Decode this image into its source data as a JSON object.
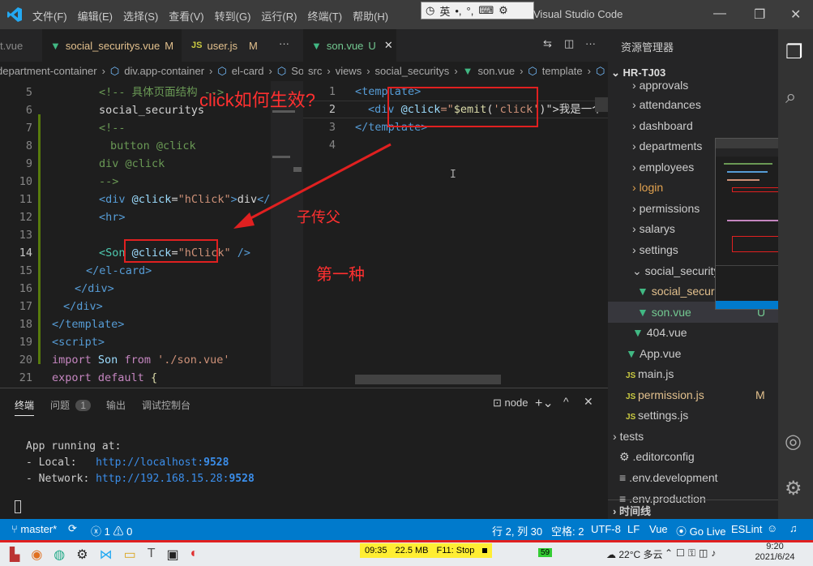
{
  "titlebar": {
    "menu": [
      "文件(F)",
      "编辑(E)",
      "选择(S)",
      "查看(V)",
      "转到(G)",
      "运行(R)",
      "终端(T)",
      "帮助(H)"
    ],
    "ime": {
      "circle": "◷",
      "lang": "英",
      "punct": "°,",
      "moon": "•,"
    },
    "window_title": "Visual Studio Code",
    "buttons": {
      "minimize": "—",
      "restore": "❐",
      "close": "✕"
    }
  },
  "left_editor": {
    "tabs": [
      {
        "label": "t.vue",
        "badge": ""
      },
      {
        "label": "social_securitys.vue",
        "badge": "M",
        "active": true
      },
      {
        "label": "user.js",
        "badge": "M",
        "prefix": "JS"
      }
    ],
    "more": "···",
    "breadcrumb": [
      "department-container",
      "div.app-container",
      "el-card",
      "Son"
    ],
    "lines": [
      {
        "n": "5",
        "html": "cmt1"
      },
      {
        "n": "6",
        "text": "social_securitys"
      },
      {
        "n": "7",
        "text": "<!--"
      },
      {
        "n": "8",
        "text": "button @click"
      },
      {
        "n": "9",
        "text": "div @click"
      },
      {
        "n": "10",
        "text": "-->"
      },
      {
        "n": "11"
      },
      {
        "n": "12"
      },
      {
        "n": "13"
      },
      {
        "n": "14"
      },
      {
        "n": "15"
      },
      {
        "n": "16"
      },
      {
        "n": "17"
      },
      {
        "n": "18"
      },
      {
        "n": "19"
      },
      {
        "n": "20"
      },
      {
        "n": "21"
      }
    ],
    "code": {
      "l5_comment": "<!-- 具体页面结构 -->",
      "l6": "social_securitys",
      "l7": "<!--",
      "l8": "button @click",
      "l9": "div @click",
      "l10": "-->",
      "l11_tag": "<div",
      "l11_attr": "@click",
      "l11_val": "\"hClick\"",
      "l11_rest": "div",
      "l11_close": "</div>",
      "l12": "<hr>",
      "l14_tag": "<Son",
      "l14_attr": "@click",
      "l14_val": "\"hClick\"",
      "l14_close": "/>",
      "l15": "</el-card>",
      "l16": "</div>",
      "l17": "</div>",
      "l18": "</template>",
      "l19": "<script>",
      "l20_kw": "import",
      "l20_name": "Son",
      "l20_from": "from",
      "l20_str": "'./son.vue'",
      "l21_kw": "export default",
      "l21_rest": "{"
    }
  },
  "annotations": {
    "question": "click如何生效?",
    "child_to_parent": "子传父",
    "first_way": "第一种"
  },
  "right_editor": {
    "tab": {
      "label": "son.vue",
      "badge": "U"
    },
    "breadcrumb": [
      "src",
      "views",
      "social_securitys",
      "son.vue",
      "template",
      "div"
    ],
    "line_numbers": [
      "1",
      "2",
      "3",
      "4"
    ],
    "code": {
      "l1": "<template>",
      "l2_tag": "<div",
      "l2_attr": "@click",
      "l2_eq": "=\"",
      "l2_fn": "$emit",
      "l2_arg": "'click'",
      "l2_tail": "\">我是一个",
      "l3": "</template>"
    }
  },
  "explorer": {
    "header": "资源管理器",
    "more": "···",
    "project": "HR-TJ03",
    "items": [
      {
        "label": "approvals",
        "type": "folder"
      },
      {
        "label": "attendances",
        "type": "folder"
      },
      {
        "label": "dashboard",
        "type": "folder"
      },
      {
        "label": "departments",
        "type": "folder"
      },
      {
        "label": "employees",
        "type": "folder"
      },
      {
        "label": "login",
        "type": "folder"
      },
      {
        "label": "permissions",
        "type": "folder"
      },
      {
        "label": "salarys",
        "type": "folder"
      },
      {
        "label": "settings",
        "type": "folder"
      },
      {
        "label": "social_securitys",
        "type": "folder-open"
      },
      {
        "label": "social_securitys",
        "type": "vue"
      },
      {
        "label": "son.vue",
        "type": "vue",
        "badge": "U"
      },
      {
        "label": "404.vue",
        "type": "vue"
      },
      {
        "label": "App.vue",
        "type": "vue"
      },
      {
        "label": "main.js",
        "type": "js"
      },
      {
        "label": "permission.js",
        "type": "js",
        "badge": "M"
      },
      {
        "label": "settings.js",
        "type": "js"
      },
      {
        "label": "tests",
        "type": "folder"
      },
      {
        "label": ".editorconfig",
        "type": "gear"
      },
      {
        "label": ".env.development",
        "type": "file"
      },
      {
        "label": ".env.production",
        "type": "file"
      }
    ],
    "timeline": "时间线"
  },
  "panel": {
    "tabs": [
      "终端",
      "问题",
      "输出",
      "调试控制台"
    ],
    "problems_count": "1",
    "terminal_name": "node",
    "output": {
      "l1": "App running at:",
      "l2_label": "- Local:   ",
      "l2_url": "http://localhost:",
      "l2_port": "9528",
      "l3_label": "- Network: ",
      "l3_url": "http://192.168.15.28:",
      "l3_port": "9528"
    }
  },
  "statusbar": {
    "branch": "master*",
    "errors": "1",
    "warnings": "0",
    "position": "行 2, 列 30",
    "spaces": "空格: 2",
    "encoding": "UTF-8",
    "eol": "LF",
    "lang": "Vue",
    "golive": "Go Live",
    "eslint": "ESLint"
  },
  "taskbar": {
    "perf": {
      "time": "09:35",
      "mem": "22.5 MB",
      "stop": "F11: Stop"
    },
    "battery": "59",
    "weather": "22°C 多云",
    "clock_time": "9:20",
    "clock_date": "2021/6/24"
  },
  "colors": {
    "accent": "#007acc",
    "annotation": "#e02020"
  }
}
